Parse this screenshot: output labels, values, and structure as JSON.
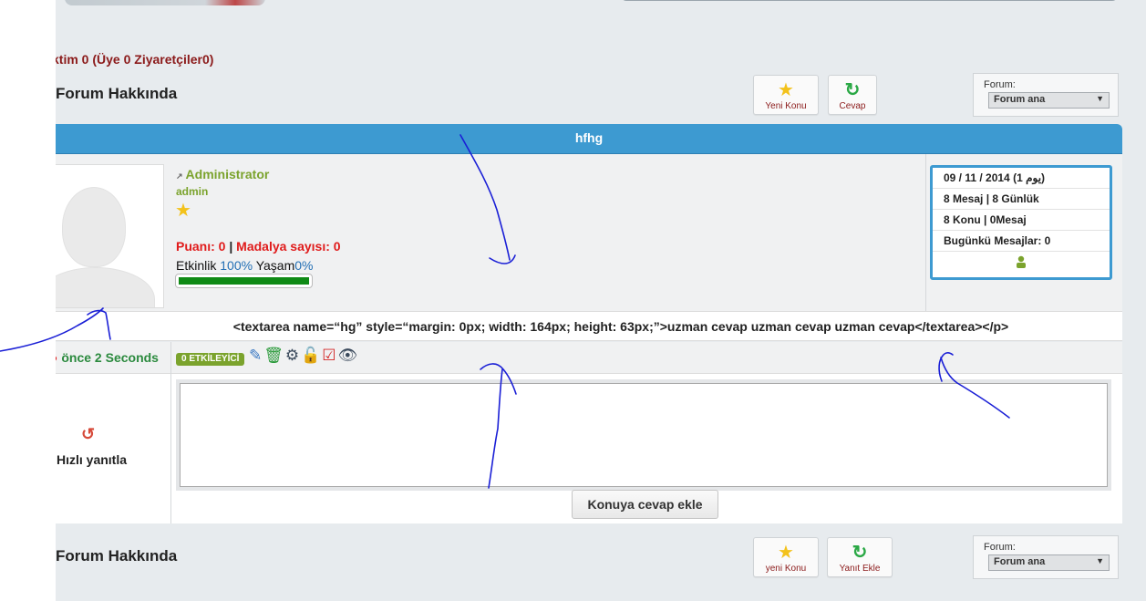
{
  "online": {
    "text": "ktim 0 (Üye 0 Ziyaretçiler0)"
  },
  "top_section": {
    "title": "Forum Hakkında",
    "buttons": {
      "new_topic": "Yeni Konu",
      "reply": "Cevap"
    },
    "forum_label": "Forum:",
    "forum_selected": "Forum ana"
  },
  "post": {
    "title": "hfhg",
    "username": "Administrator",
    "role": "admin",
    "points_label": "Puanı: 0",
    "medal_label": "Madalya sayısı: 0",
    "activity_label": "Etkinlik",
    "activity_value": "100%",
    "life_label": "Yaşam",
    "life_value": "0%",
    "progress": 1.0,
    "info": {
      "date": "09 / 11 / 2014 (1 يوم)",
      "messages": "8 Mesaj | 8 Günlük",
      "topics": "8 Konu | 0Mesaj",
      "today": "Bugünkü Mesajlar: 0"
    },
    "message": "<textarea name=“hg” style=“margin: 0px; width: 164px; height: 63px;”>uzman cevap uzman cevap uzman cevap</textarea></p>",
    "time_ago": "önce 2 Seconds",
    "badge": "0 ETKİLEYİCİ"
  },
  "quick_reply": {
    "label": "Hızlı yanıtla",
    "textarea_value": "",
    "submit": "Konuya cevap ekle"
  },
  "bottom_section": {
    "title": "Forum Hakkında",
    "buttons": {
      "new_topic": "yeni Konu",
      "reply": "Yanıt Ekle"
    },
    "forum_label": "Forum:",
    "forum_selected": "Forum ana"
  },
  "colors": {
    "accent_blue": "#3d9ad1",
    "green": "#7ba32d",
    "dark_red": "#8b1a1a",
    "red": "#e01b1b",
    "annotation_ink": "#1a1fd6"
  }
}
